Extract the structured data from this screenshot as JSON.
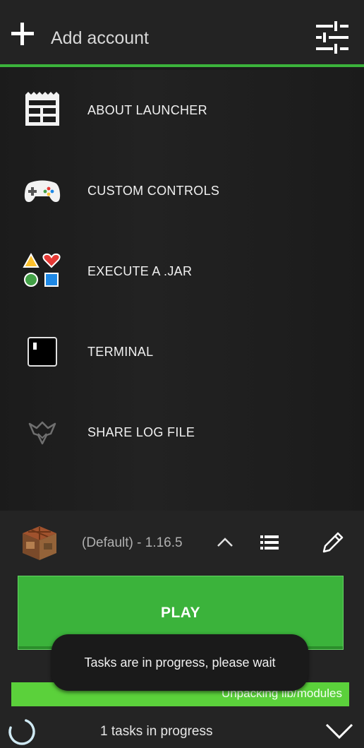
{
  "header": {
    "add_account_label": "Add account"
  },
  "menu": {
    "items": [
      {
        "label": "ABOUT LAUNCHER",
        "icon": "about-icon"
      },
      {
        "label": "CUSTOM CONTROLS",
        "icon": "gamepad-icon"
      },
      {
        "label": "EXECUTE A .JAR",
        "icon": "shapes-icon"
      },
      {
        "label": "TERMINAL",
        "icon": "terminal-icon"
      },
      {
        "label": "SHARE LOG FILE",
        "icon": "share-log-icon"
      }
    ]
  },
  "profile": {
    "version_label": "(Default) - 1.16.5"
  },
  "play": {
    "label": "PLAY"
  },
  "toast": {
    "message": "Tasks are in progress, please wait"
  },
  "progress": {
    "label": "Unpacking lib/modules",
    "fraction": 1.0
  },
  "status": {
    "tasks_label": "1 tasks in progress"
  },
  "colors": {
    "accent": "#3bb33b",
    "progress": "#5bd13b",
    "background": "#1c1c1c"
  }
}
